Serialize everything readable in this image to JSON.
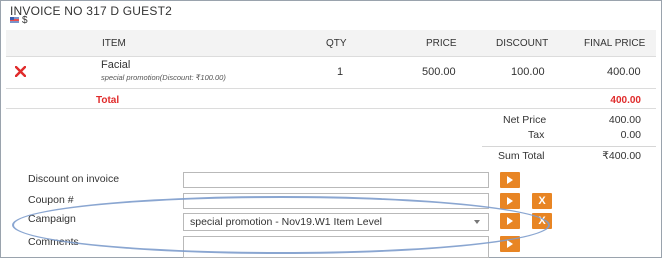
{
  "invoice": {
    "title": "INVOICE NO 317  D GUEST2",
    "flag_icon": "uk-flag-icon",
    "currency_symbol": "$"
  },
  "table": {
    "headers": [
      "ITEM",
      "QTY",
      "PRICE",
      "DISCOUNT",
      "FINAL PRICE"
    ],
    "rows": [
      {
        "delete_icon": "red-x-icon",
        "item": "Facial",
        "item_note": "special promotion(Discount: ₹100.00)",
        "qty": "1",
        "price": "500.00",
        "discount": "100.00",
        "final_price": "400.00"
      }
    ],
    "total_label": "Total",
    "total_value": "400.00"
  },
  "summary": {
    "net_price_label": "Net Price",
    "net_price_value": "400.00",
    "tax_label": "Tax",
    "tax_value": "0.00",
    "sum_total_label": "Sum Total",
    "sum_total_value": "₹400.00"
  },
  "form": {
    "discount_label": "Discount on invoice",
    "discount_value": "",
    "coupon_label": "Coupon #",
    "coupon_value": "",
    "campaign_label": "Campaign",
    "campaign_selected": "special promotion - Nov19.W1 Item Level",
    "comments_label": "Comments",
    "apply_button_glyph": "play-icon",
    "clear_button_label": "X"
  },
  "colors": {
    "accent_orange": "#e88524",
    "total_red": "#e02b2b",
    "highlight_oval": "#7d9ccc"
  }
}
